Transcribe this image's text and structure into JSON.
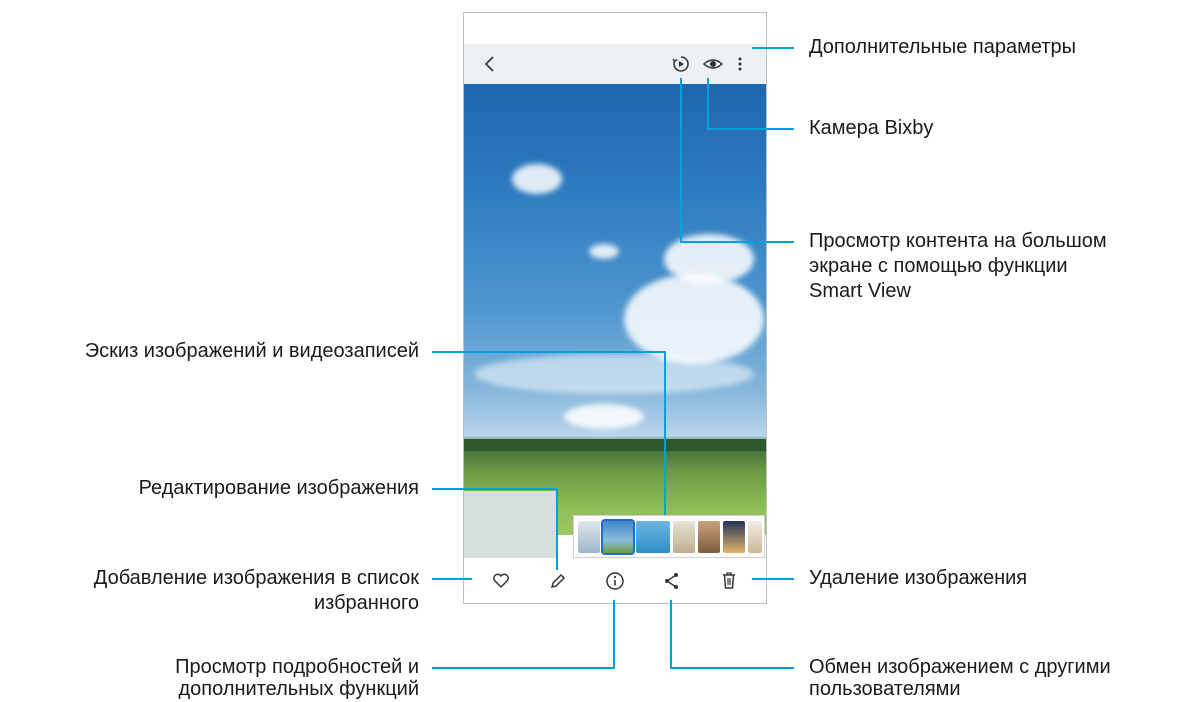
{
  "labels": {
    "more_options": "Дополнительные параметры",
    "bixby_vision": "Камера Bixby",
    "smart_view_line1": "Просмотр контента на большом",
    "smart_view_line2": "экране с помощью функции",
    "smart_view_line3": "Smart View",
    "thumbnails": "Эскиз изображений и видеозаписей",
    "edit": "Редактирование изображения",
    "favorite_line1": "Добавление изображения в список",
    "favorite_line2": "избранного",
    "delete": "Удаление изображения",
    "details_line1": "Просмотр подробностей и",
    "details_line2": "дополнительных функций",
    "share_line1": "Обмен изображением с другими",
    "share_line2": "пользователями"
  },
  "icons": {
    "back": "back-icon",
    "smart_view": "smart-view-icon",
    "bixby": "eye-icon",
    "more": "more-vertical-icon",
    "favorite": "heart-icon",
    "edit": "pencil-icon",
    "details": "info-icon",
    "share": "share-icon",
    "delete": "trash-icon"
  },
  "colors": {
    "callout_line": "#00a3d9",
    "thumbnail_selected": "#1b6ad6"
  }
}
